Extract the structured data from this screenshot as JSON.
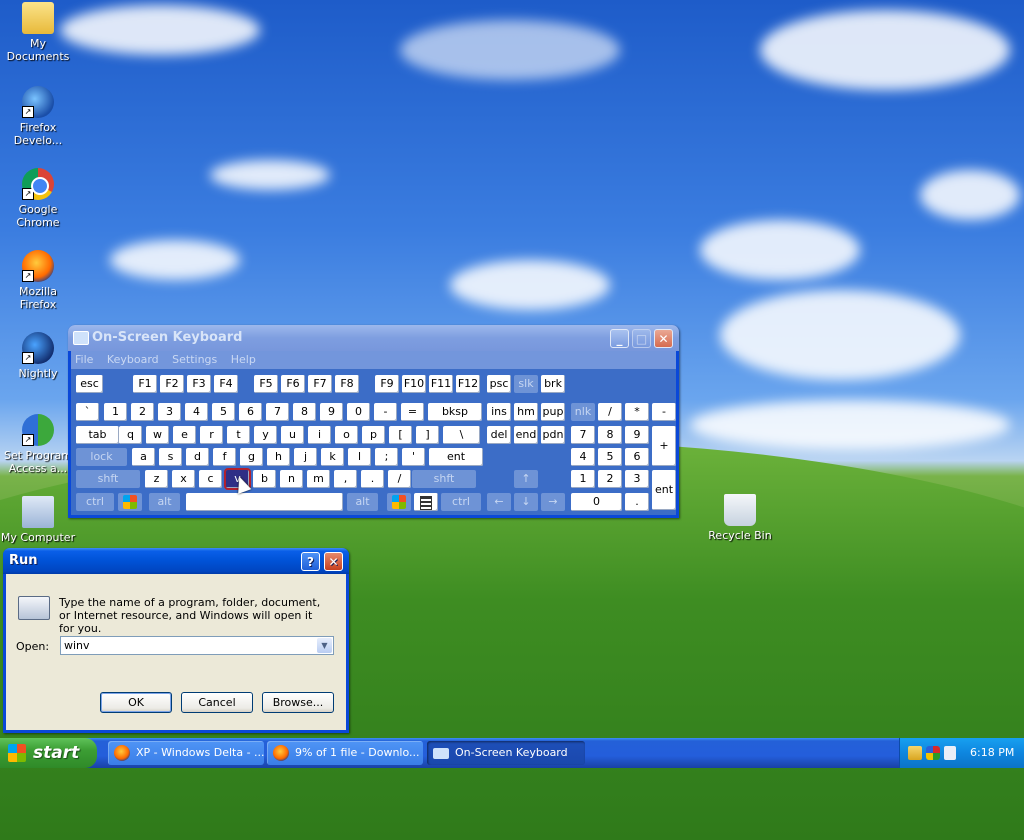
{
  "desktop": {
    "icons": [
      {
        "label": "My Documents"
      },
      {
        "label": "Firefox Develo..."
      },
      {
        "label": "Google Chrome"
      },
      {
        "label": "Mozilla Firefox"
      },
      {
        "label": "Nightly"
      },
      {
        "label": "Set Program Access a..."
      },
      {
        "label": "My Computer"
      },
      {
        "label": "Recycle Bin"
      }
    ]
  },
  "osk": {
    "title": "On-Screen Keyboard",
    "menu": [
      "File",
      "Keyboard",
      "Settings",
      "Help"
    ],
    "row1": [
      "esc",
      "F1",
      "F2",
      "F3",
      "F4",
      "F5",
      "F6",
      "F7",
      "F8",
      "F9",
      "F10",
      "F11",
      "F12",
      "psc",
      "slk",
      "brk"
    ],
    "row2": [
      "`",
      "1",
      "2",
      "3",
      "4",
      "5",
      "6",
      "7",
      "8",
      "9",
      "0",
      "-",
      "=",
      "bksp",
      "ins",
      "hm",
      "pup",
      "nlk",
      "/",
      "*",
      "-"
    ],
    "row3": [
      "tab",
      "q",
      "w",
      "e",
      "r",
      "t",
      "y",
      "u",
      "i",
      "o",
      "p",
      "[",
      "]",
      "\\",
      "del",
      "end",
      "pdn",
      "7",
      "8",
      "9",
      "+"
    ],
    "row4": [
      "lock",
      "a",
      "s",
      "d",
      "f",
      "g",
      "h",
      "j",
      "k",
      "l",
      ";",
      "'",
      "ent",
      "4",
      "5",
      "6"
    ],
    "row5": [
      "shft",
      "z",
      "x",
      "c",
      "v",
      "b",
      "n",
      "m",
      ",",
      ".",
      "/",
      "shft",
      "↑",
      "1",
      "2",
      "3",
      "ent"
    ],
    "row6": [
      "ctrl",
      "alt",
      "alt",
      "ctrl",
      "←",
      "↓",
      "→",
      "0",
      "."
    ]
  },
  "run": {
    "title": "Run",
    "description": "Type the name of a program, folder, document, or Internet resource, and Windows will open it for you.",
    "open_label": "Open:",
    "open_value": "winv",
    "ok": "OK",
    "cancel": "Cancel",
    "browse": "Browse..."
  },
  "taskbar": {
    "start": "start",
    "tasks": [
      {
        "label": "XP - Windows Delta - ..."
      },
      {
        "label": "9% of 1 file - Downlo..."
      },
      {
        "label": "On-Screen Keyboard"
      }
    ],
    "clock": "6:18 PM"
  }
}
